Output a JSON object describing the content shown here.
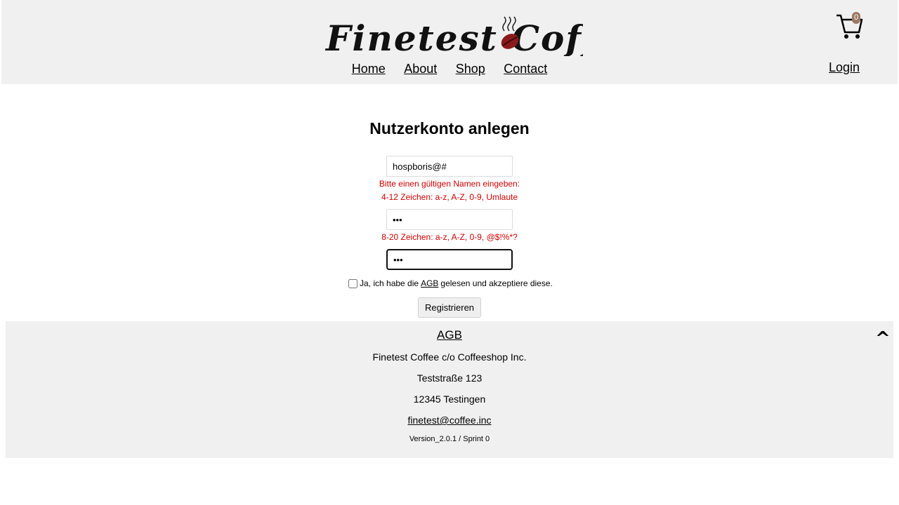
{
  "header": {
    "brand": "Finetest Coffee",
    "nav": [
      {
        "label": "Home"
      },
      {
        "label": "About"
      },
      {
        "label": "Shop"
      },
      {
        "label": "Contact"
      }
    ],
    "cart_count": "0",
    "login_label": "Login"
  },
  "form": {
    "title": "Nutzerkonto anlegen",
    "username_value": "hospboris@#",
    "username_error_1": "Bitte einen gültigen Namen eingeben:",
    "username_error_2": "4-12 Zeichen: a-z, A-Z, 0-9, Umlaute",
    "password_value": "•••",
    "password_error": "8-20 Zeichen: a-z, A-Z, 0-9, @$!%*?",
    "confirm_value": "•••",
    "agb_prefix": "Ja, ich habe die",
    "agb_link": "AGB",
    "agb_suffix": "gelesen und akzeptiere diese.",
    "submit_label": "Registrieren"
  },
  "footer": {
    "agb": "AGB",
    "company": "Finetest Coffee c/o Coffeeshop Inc.",
    "street": "Teststraße 123",
    "city": "12345 Testingen",
    "email": "finetest@coffee.inc",
    "version": "Version_2.0.1 / Sprint 0",
    "to_top": "^"
  },
  "colors": {
    "header_bg": "#f0f0f0",
    "error": "#d00000",
    "bean": "#8b1a1a",
    "badge": "#9b7a62"
  }
}
